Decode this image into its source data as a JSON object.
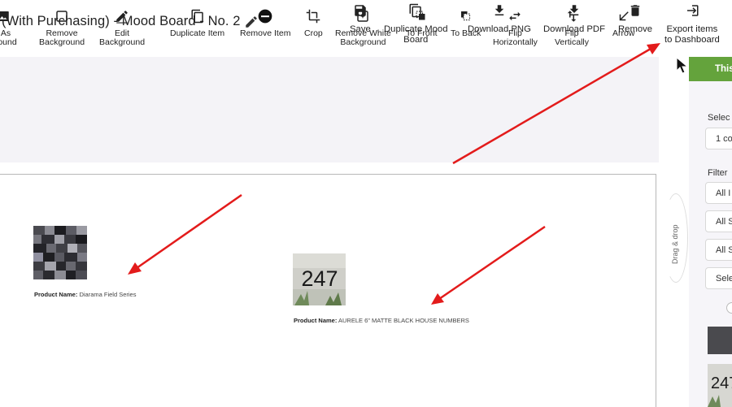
{
  "header": {
    "title": "(With Purchasing) - Mood Board - No. 2",
    "actions": [
      {
        "label_line1": "Save",
        "label_line2": "",
        "icon": "save-icon"
      },
      {
        "label_line1": "Duplicate Mood",
        "label_line2": "Board",
        "icon": "duplicate-icon"
      },
      {
        "label_line1": "Download PNG",
        "label_line2": "",
        "icon": "download-icon"
      },
      {
        "label_line1": "Download PDF",
        "label_line2": "",
        "icon": "download-icon"
      },
      {
        "label_line1": "Remove",
        "label_line2": "",
        "icon": "trash-icon"
      },
      {
        "label_line1": "Export items",
        "label_line2": "to Dashboard",
        "icon": "export-icon"
      }
    ]
  },
  "toolbar": {
    "tools": [
      {
        "label_line1": "t As",
        "label_line2": "ground",
        "icon": "image-icon"
      },
      {
        "label_line1": "Remove",
        "label_line2": "Background",
        "icon": "square-outline-icon"
      },
      {
        "label_line1": "Edit",
        "label_line2": "Background",
        "icon": "pencil-icon"
      },
      {
        "label_line1": "Duplicate Item",
        "label_line2": "",
        "icon": "duplicate-icon"
      },
      {
        "label_line1": "Remove Item",
        "label_line2": "",
        "icon": "minus-circle-icon"
      },
      {
        "label_line1": "Crop",
        "label_line2": "",
        "icon": "crop-icon"
      },
      {
        "label_line1": "Remove White",
        "label_line2": "Background",
        "icon": "sparkle-square-icon"
      },
      {
        "label_line1": "To Front",
        "label_line2": "",
        "icon": "bring-front-icon"
      },
      {
        "label_line1": "To Back",
        "label_line2": "",
        "icon": "send-back-icon"
      },
      {
        "label_line1": "Flip",
        "label_line2": "Horizontally",
        "icon": "flip-horizontal-icon"
      },
      {
        "label_line1": "Flip",
        "label_line2": "Vertically",
        "icon": "flip-vertical-icon"
      },
      {
        "label_line1": "Arrow",
        "label_line2": "",
        "icon": "arrow-icon"
      }
    ]
  },
  "canvas": {
    "products": [
      {
        "label": "Product Name:",
        "name": "Diarama Field Series"
      },
      {
        "label": "Product Name:",
        "name": "AURELE 6\" MATTE BLACK HOUSE NUMBERS",
        "number_text": "247"
      }
    ]
  },
  "sidebar": {
    "drag_drop_label": "Drag & drop",
    "tab_label": "This",
    "select_label": "Selec",
    "select_value": "1 co",
    "filter_label": "Filter",
    "filters": [
      "All I",
      "All S",
      "All S",
      "Sele"
    ]
  },
  "colors": {
    "accent_green": "#64a33c",
    "annotation_red": "#e31b1b",
    "toolbar_bg": "#f4f3f7"
  }
}
